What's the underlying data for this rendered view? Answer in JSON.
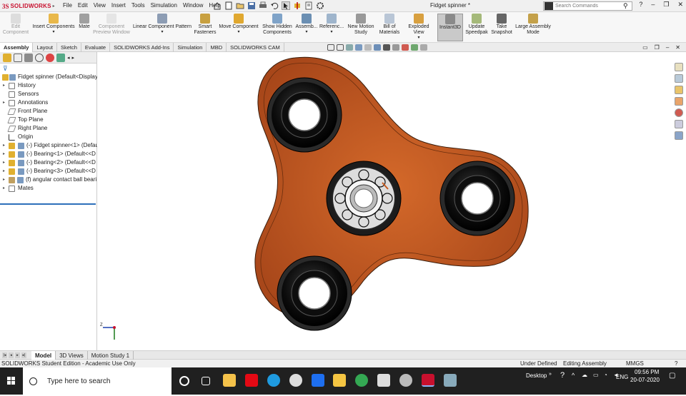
{
  "app": {
    "brand_ds": "3S",
    "brand_name": "SOLIDWORKS",
    "document_title": "Fidget spinner *",
    "search_placeholder": "Search Commands"
  },
  "menu": [
    "File",
    "Edit",
    "View",
    "Insert",
    "Tools",
    "Simulation",
    "Window",
    "Help"
  ],
  "commands": [
    {
      "label": "Edit\nComponent",
      "enabled": false
    },
    {
      "label": "Insert Components",
      "enabled": true
    },
    {
      "label": "Mate",
      "enabled": true
    },
    {
      "label": "Component\nPreview Window",
      "enabled": false
    },
    {
      "label": "Linear Component Pattern",
      "enabled": true
    },
    {
      "label": "Smart\nFasteners",
      "enabled": true
    },
    {
      "label": "Move Component",
      "enabled": true
    },
    {
      "label": "Show Hidden\nComponents",
      "enabled": true
    },
    {
      "label": "Assemb...",
      "enabled": true
    },
    {
      "label": "Referenc...",
      "enabled": true
    },
    {
      "label": "New Motion\nStudy",
      "enabled": true
    },
    {
      "label": "Bill of\nMaterials",
      "enabled": true
    },
    {
      "label": "Exploded View",
      "enabled": true
    },
    {
      "label": "Instant3D",
      "enabled": true,
      "active": true
    },
    {
      "label": "Update\nSpeedpak",
      "enabled": true
    },
    {
      "label": "Take\nSnapshot",
      "enabled": true
    },
    {
      "label": "Large Assembly\nMode",
      "enabled": true
    }
  ],
  "tabs": [
    "Assembly",
    "Layout",
    "Sketch",
    "Evaluate",
    "SOLIDWORKS Add-Ins",
    "Simulation",
    "MBD",
    "SOLIDWORKS CAM"
  ],
  "active_tab": "Assembly",
  "tree": [
    {
      "label": "Fidget spinner  (Default<Display",
      "level": 0,
      "icon": "assembly-icon"
    },
    {
      "label": "History",
      "level": 1,
      "icon": "history-icon"
    },
    {
      "label": "Sensors",
      "level": 1,
      "icon": "sensors-icon"
    },
    {
      "label": "Annotations",
      "level": 1,
      "icon": "annotations-icon"
    },
    {
      "label": "Front Plane",
      "level": 1,
      "icon": "plane-icon"
    },
    {
      "label": "Top Plane",
      "level": 1,
      "icon": "plane-icon"
    },
    {
      "label": "Right Plane",
      "level": 1,
      "icon": "plane-icon"
    },
    {
      "label": "Origin",
      "level": 1,
      "icon": "origin-icon"
    },
    {
      "label": "(-) Fidget spinner<1> (Defaul",
      "level": 1,
      "icon": "part-icon"
    },
    {
      "label": "(-) Bearing<1> (Default<<D",
      "level": 1,
      "icon": "subassembly-icon"
    },
    {
      "label": "(-) Bearing<2> (Default<<D",
      "level": 1,
      "icon": "subassembly-icon"
    },
    {
      "label": "(-) Bearing<3> (Default<<D",
      "level": 1,
      "icon": "subassembly-icon"
    },
    {
      "label": "(f) angular contact ball beari",
      "level": 1,
      "icon": "subassembly-icon"
    },
    {
      "label": "Mates",
      "level": 1,
      "icon": "mates-icon"
    }
  ],
  "bottom_tabs": [
    "Model",
    "3D Views",
    "Motion Study 1"
  ],
  "active_bottom_tab": "Model",
  "status": {
    "left": "SOLIDWORKS Student Edition - Academic Use Only",
    "definition": "Under Defined",
    "mode": "Editing Assembly",
    "units": "MMGS"
  },
  "taskbar": {
    "search_placeholder": "Type here to search",
    "desktop_label": "Desktop",
    "language": "ENG",
    "time": "09:56 PM",
    "date": "20-07-2020"
  },
  "colors": {
    "spinner_body": "#c65a1e",
    "bearing": "#111111",
    "accent": "#2d6fba",
    "brand": "#c8102e"
  }
}
